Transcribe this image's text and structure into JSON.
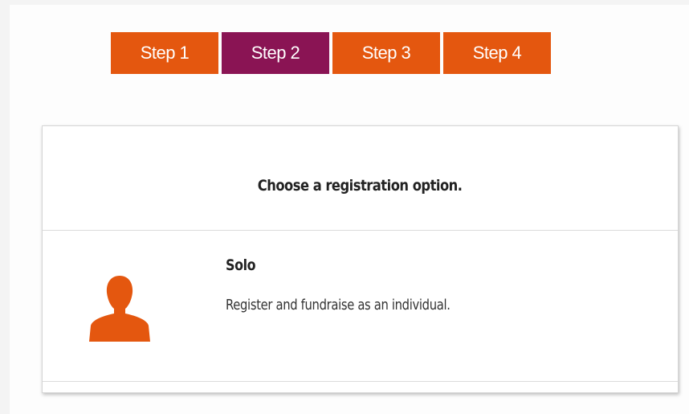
{
  "steps": [
    {
      "label": "Step 1",
      "active": false
    },
    {
      "label": "Step 2",
      "active": true
    },
    {
      "label": "Step 3",
      "active": false
    },
    {
      "label": "Step 4",
      "active": false
    }
  ],
  "colors": {
    "step_inactive": "#e4570f",
    "step_active": "#8a1454",
    "icon": "#e4570f"
  },
  "card": {
    "title": "Choose a registration option."
  },
  "options": [
    {
      "icon": "person-icon",
      "title": "Solo",
      "description": "Register and fundraise as an individual."
    }
  ]
}
